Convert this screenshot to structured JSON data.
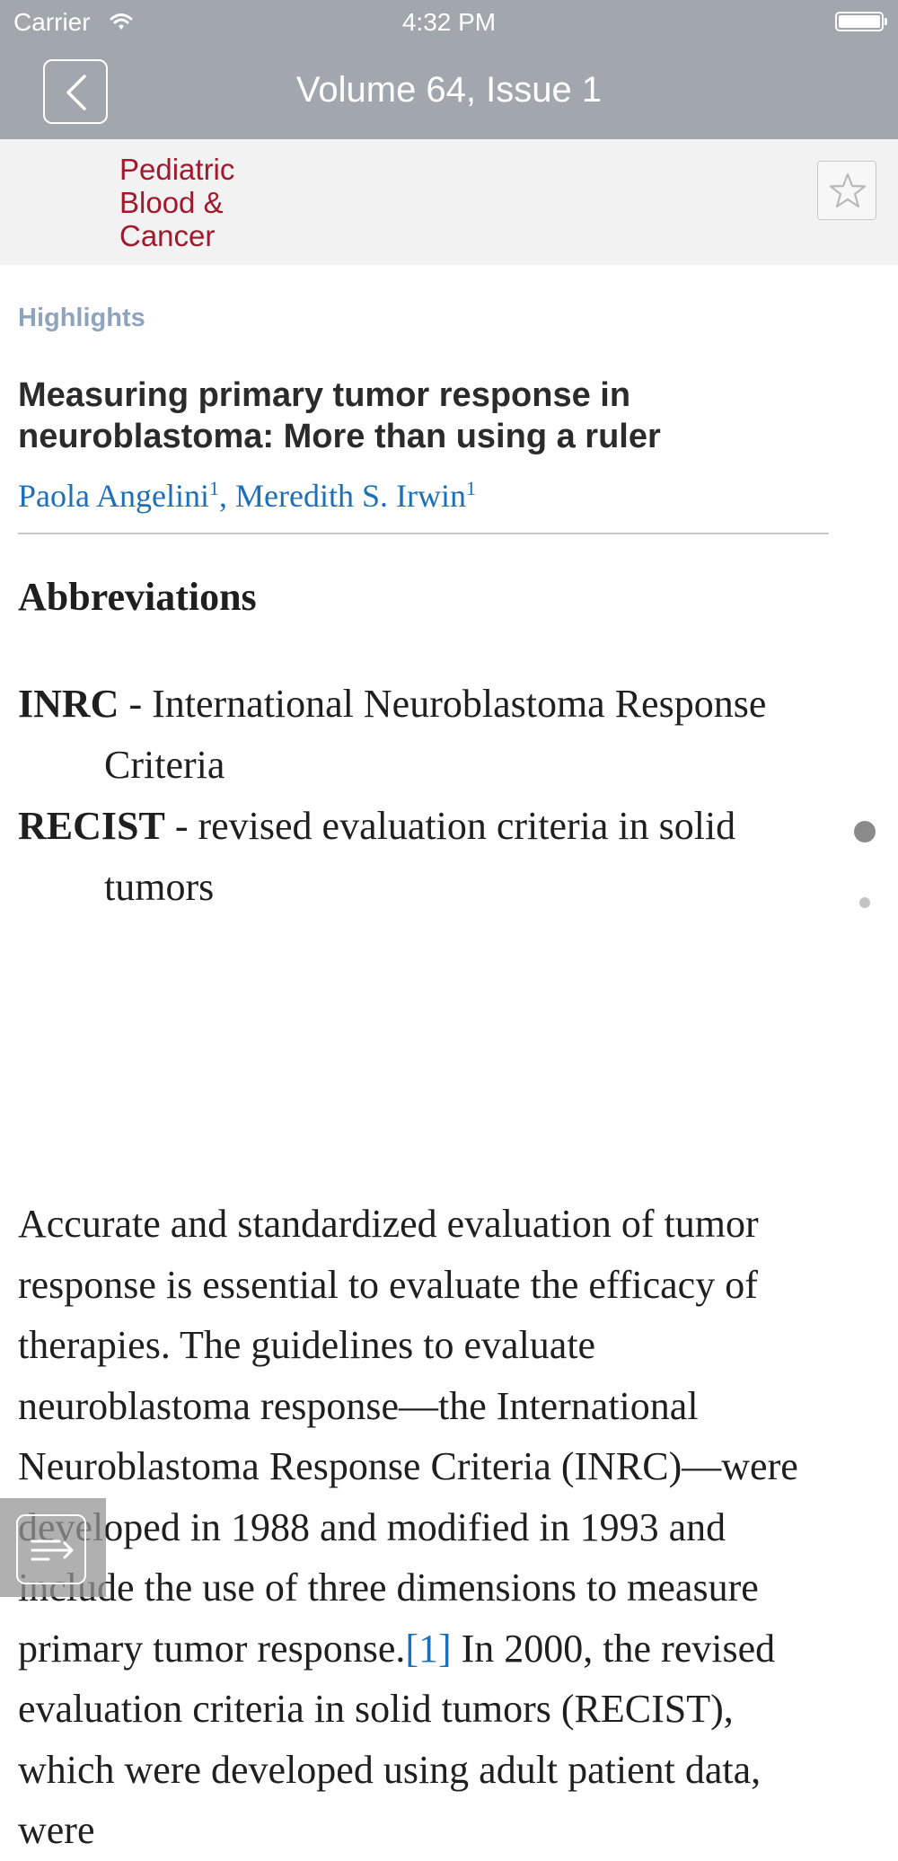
{
  "status_bar": {
    "carrier": "Carrier",
    "time": "4:32 PM",
    "icons": [
      "wifi-icon",
      "battery-icon"
    ]
  },
  "nav": {
    "title": "Volume 64, Issue 1",
    "back_icon": "chevron-left-icon"
  },
  "journal": {
    "name_lines": [
      "Pediatric",
      "Blood &",
      "Cancer"
    ],
    "bookmark_icon": "star-icon"
  },
  "article": {
    "section": "Highlights",
    "title": "Measuring primary tumor response in neuroblastoma: More than using a ruler",
    "authors": [
      {
        "name": "Paola Angelini",
        "affiliation": "1"
      },
      {
        "name": "Meredith S. Irwin",
        "affiliation": "1"
      }
    ],
    "abbreviations_heading": "Abbreviations",
    "abbreviations": [
      {
        "term": "INRC",
        "definition": "- International Neuroblastoma Response Criteria"
      },
      {
        "term": "RECIST",
        "definition": "- revised evaluation criteria in solid tumors"
      }
    ],
    "body_before_ref": "Accurate and standardized evaluation of tumor response is essential to evaluate the efficacy of therapies. The guidelines to evaluate neuroblastoma response—the International Neuroblastoma Response Criteria (INRC)—were developed in 1988 and modified in 1993 and include the use of three dimensions to measure primary tumor response.",
    "ref_label": "[1]",
    "body_after_ref": " In 2000, the revised evaluation criteria in solid tumors (RECIST), which were developed using adult patient data, were"
  },
  "page_indicator": {
    "pages": 2,
    "current": 1
  },
  "toc_button": {
    "icon": "table-of-contents-icon"
  },
  "colors": {
    "bar": "#a2a7ad",
    "journal_red": "#a1192c",
    "link_blue": "#1d6fb8",
    "section_label": "#8ea3bd"
  }
}
